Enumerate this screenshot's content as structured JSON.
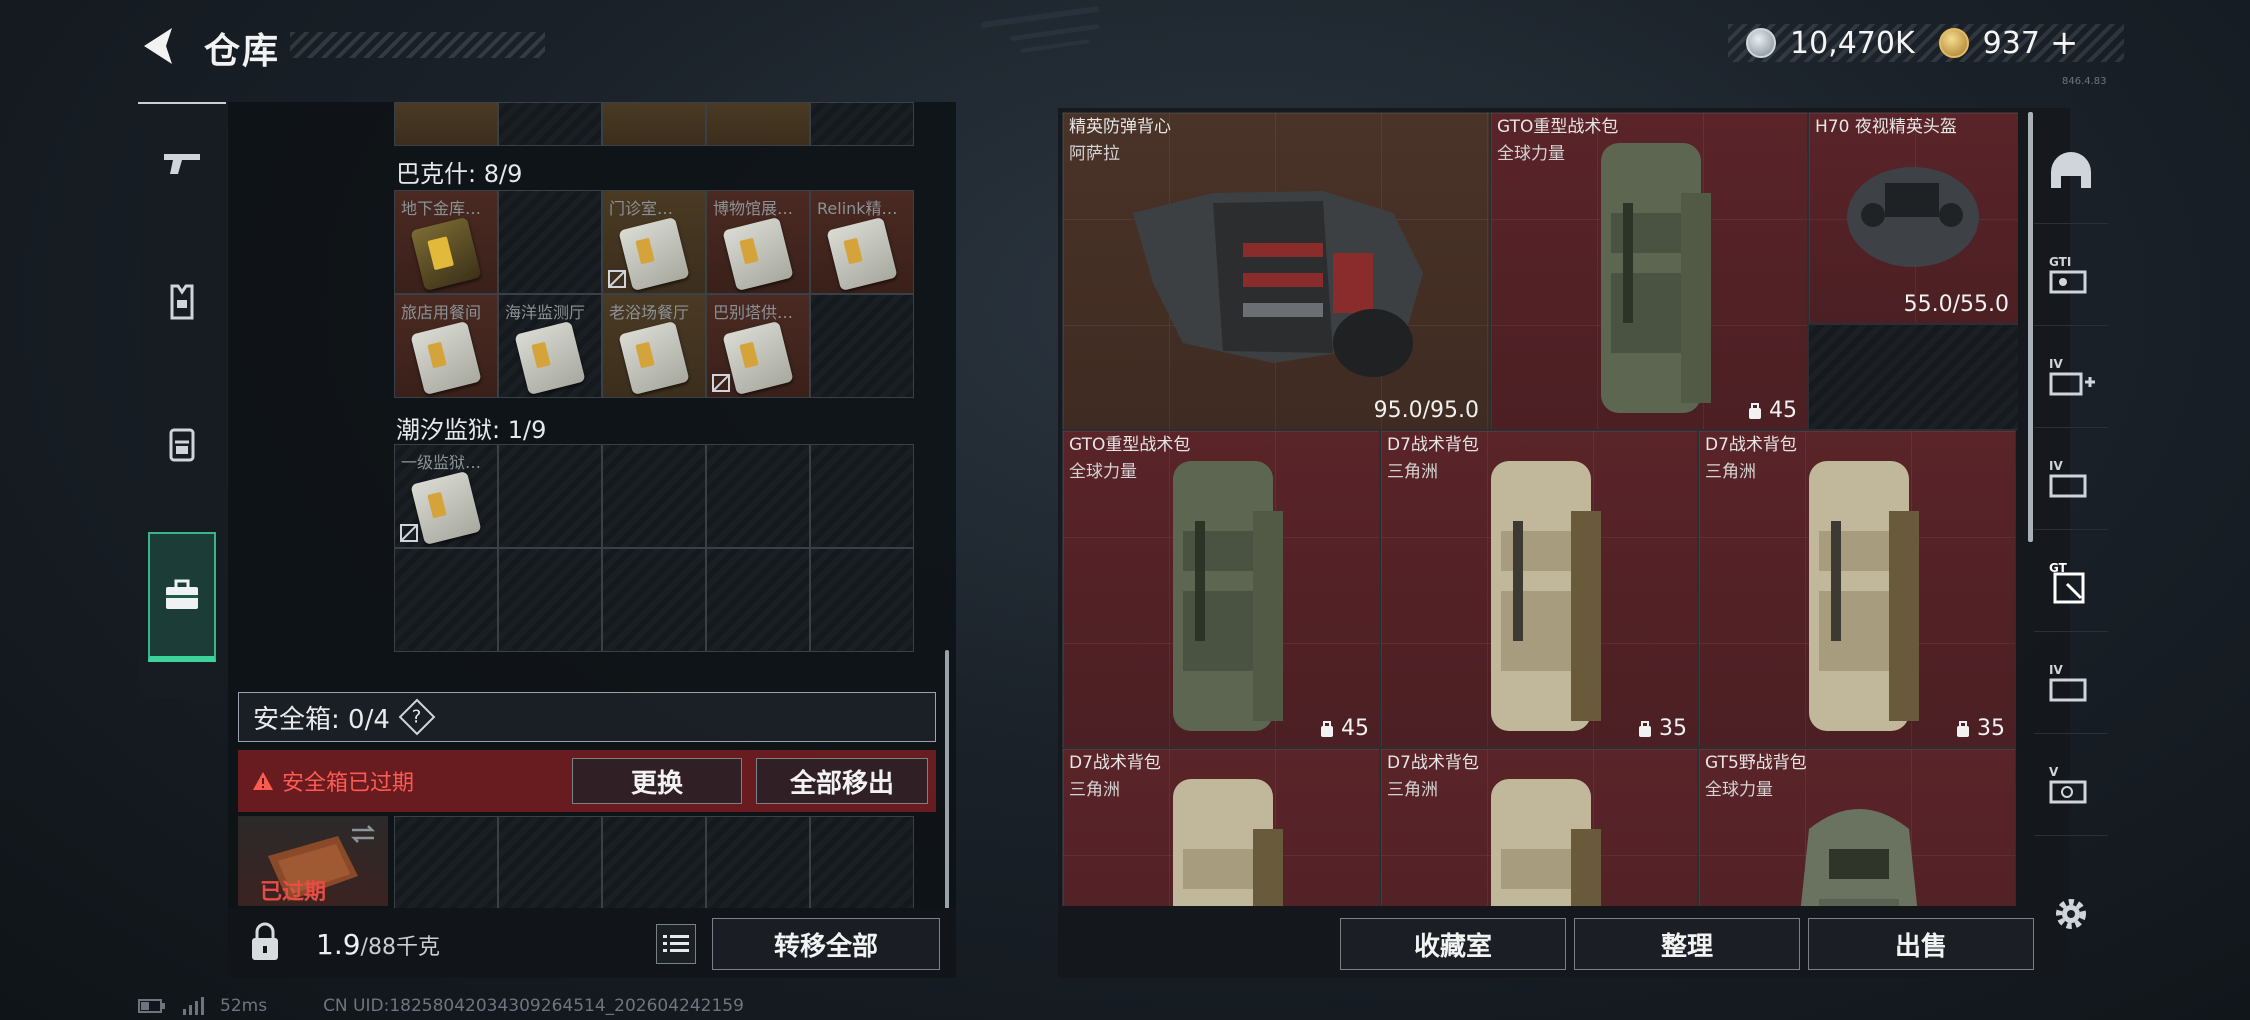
{
  "header": {
    "title": "仓库"
  },
  "currency": {
    "silver": "10,470K",
    "gold": "937"
  },
  "version": "846.4.83",
  "left_nav": [
    "weapon-tab",
    "gear-tab",
    "backpack-tab",
    "warehouse-tab"
  ],
  "sections": {
    "bakeshi": {
      "label": "巴克什: 8/9",
      "items": [
        "地下金库…",
        "",
        "门诊室…",
        "博物馆展…",
        "Relink精…",
        "旅店用餐间",
        "海洋监测厅",
        "老浴场餐厅",
        "巴别塔供…"
      ]
    },
    "chaoxi": {
      "label": "潮汐监狱: 1/9",
      "items": [
        "一级监狱…"
      ]
    }
  },
  "safebox": {
    "label": "安全箱: 0/4",
    "help": "?",
    "warning": "安全箱已过期",
    "replace_btn": "更换",
    "move_all_out_btn": "全部移出",
    "expired_stamp": "已过期"
  },
  "weight": {
    "value": "1.9",
    "capacity": "/88千克"
  },
  "transfer_all_btn": "转移全部",
  "stash_items": [
    {
      "name": "精英防弹背心",
      "sub": "阿萨拉",
      "durability": "95.0/95.0"
    },
    {
      "name": "GTO重型战术包",
      "sub": "全球力量",
      "capacity": "45"
    },
    {
      "name": "H70 夜视精英头盔",
      "sub": "",
      "durability": "55.0/55.0"
    },
    {
      "name": "GTO重型战术包",
      "sub": "全球力量",
      "capacity": "45"
    },
    {
      "name": "D7战术背包",
      "sub": "三角洲",
      "capacity": "35"
    },
    {
      "name": "D7战术背包",
      "sub": "三角洲",
      "capacity": "35"
    },
    {
      "name": "D7战术背包",
      "sub": "三角洲",
      "capacity": ""
    },
    {
      "name": "D7战术背包",
      "sub": "三角洲",
      "capacity": ""
    },
    {
      "name": "GT5野战背包",
      "sub": "全球力量",
      "capacity": ""
    }
  ],
  "right_nav": [
    "helmet-tab",
    "gti-tab",
    "iv-plus-tab",
    "iv-tab",
    "gt-active-tab",
    "iv-tab-2",
    "v-tab"
  ],
  "bottom_buttons": {
    "collection": "收藏室",
    "organize": "整理",
    "sell": "出售"
  },
  "status": {
    "ping": "52ms",
    "uid": "CN UID:18258042034309264514_202604242159"
  },
  "colors": {
    "accent_green": "#3bd29b",
    "rarity_red": "#5a2429",
    "warning_red": "#ff5a52"
  }
}
